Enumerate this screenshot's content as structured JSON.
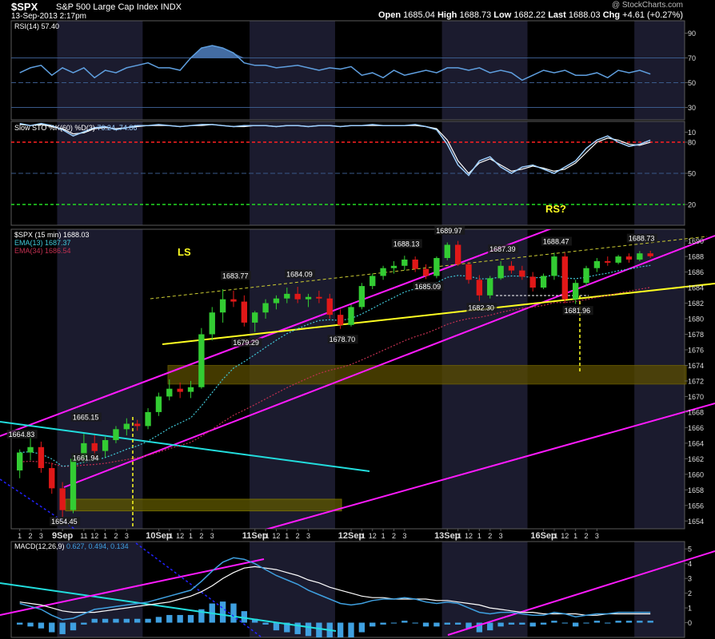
{
  "header": {
    "symbol": "$SPX",
    "name": "S&P 500 Large Cap Index",
    "exchange": "INDX",
    "datetime": "13-Sep-2013 2:17pm",
    "credit": "@ StockCharts.com",
    "open_label": "Open",
    "open": "1685.04",
    "high_label": "High",
    "high": "1688.73",
    "low_label": "Low",
    "low": "1682.22",
    "last_label": "Last",
    "last": "1688.03",
    "chg_label": "Chg",
    "chg": "+4.61 (+0.27%)"
  },
  "colors": {
    "background": "#000000",
    "panel_border": "#5a5a5a",
    "session_shade": "#1b1b2e",
    "candle_up": "#33cc33",
    "candle_down": "#e01818",
    "ema13": "#40c8d8",
    "ema34": "#c03050",
    "magenta": "#ff1aff",
    "cyan": "#22dddd",
    "yellow": "#ffff22",
    "rsi_line": "#5f9fdf",
    "sto_k": "#9fd0ff",
    "macd_hist": "#3fa0e0"
  },
  "chart_data": [
    {
      "panel": "rsi",
      "type": "line",
      "label": "RSI(14) 57.40",
      "ylim": [
        20,
        100
      ],
      "yticks": [
        90,
        70,
        50,
        30,
        10
      ],
      "reference_lines": [
        70,
        50,
        30
      ],
      "values": [
        58,
        62,
        64,
        56,
        62,
        58,
        62,
        54,
        60,
        58,
        62,
        64,
        66,
        62,
        62,
        60,
        70,
        78,
        80,
        78,
        74,
        66,
        64,
        64,
        62,
        63,
        64,
        62,
        60,
        62,
        61,
        63,
        56,
        58,
        54,
        60,
        56,
        58,
        60,
        58,
        62,
        62,
        60,
        62,
        58,
        60,
        58,
        52,
        56,
        60,
        58,
        60,
        56,
        56,
        58,
        54,
        60,
        58,
        60,
        57
      ]
    },
    {
      "panel": "sto",
      "type": "line",
      "label": "Slow STO %K(60) %D(3)",
      "label_values": "76.24, 74.86",
      "ylim": [
        0,
        100
      ],
      "yticks": [
        80,
        50,
        20
      ],
      "reference_lines": [
        80,
        50,
        20
      ],
      "k": [
        98,
        96,
        98,
        96,
        92,
        86,
        90,
        94,
        95,
        92,
        94,
        96,
        96,
        97,
        96,
        95,
        96,
        97,
        97,
        96,
        95,
        96,
        96,
        96,
        95,
        96,
        96,
        95,
        96,
        96,
        95,
        96,
        96,
        97,
        96,
        96,
        96,
        97,
        95,
        92,
        78,
        58,
        48,
        62,
        66,
        56,
        50,
        56,
        58,
        54,
        50,
        56,
        62,
        74,
        82,
        86,
        80,
        76,
        78,
        82
      ],
      "d": [
        97,
        96,
        97,
        95,
        93,
        88,
        89,
        93,
        94,
        93,
        94,
        95,
        96,
        96,
        96,
        95,
        96,
        96,
        97,
        96,
        95,
        95,
        96,
        96,
        95,
        96,
        96,
        95,
        96,
        96,
        95,
        96,
        96,
        96,
        96,
        96,
        96,
        96,
        95,
        93,
        82,
        62,
        50,
        60,
        64,
        58,
        52,
        54,
        57,
        55,
        52,
        54,
        60,
        70,
        80,
        84,
        82,
        78,
        77,
        80
      ]
    },
    {
      "panel": "price",
      "type": "candlestick",
      "label": "$SPX (15 min) 1688.03",
      "ema13_label": "EMA(13) 1687.37",
      "ema34_label": "EMA(34) 1686.54",
      "ylim": [
        1653,
        1691.5
      ],
      "yticks": [
        1690,
        1688,
        1686,
        1684,
        1682,
        1680,
        1678,
        1676,
        1674,
        1672,
        1670,
        1668,
        1666,
        1664,
        1662,
        1660,
        1658,
        1656,
        1654
      ],
      "candles": [
        [
          1660.5,
          1663.2,
          1659.5,
          1662.8
        ],
        [
          1662.8,
          1664.8,
          1661.8,
          1663.5
        ],
        [
          1663.5,
          1664.2,
          1660.2,
          1660.8
        ],
        [
          1660.8,
          1661.5,
          1657.5,
          1658.2
        ],
        [
          1658.2,
          1659.0,
          1654.5,
          1655.4
        ],
        [
          1655.4,
          1662.5,
          1655.0,
          1662.0
        ],
        [
          1662.0,
          1665.2,
          1661.5,
          1664.0
        ],
        [
          1664.0,
          1665.0,
          1662.0,
          1663.0
        ],
        [
          1663.0,
          1664.8,
          1662.2,
          1664.4
        ],
        [
          1664.4,
          1666.2,
          1664.0,
          1665.8
        ],
        [
          1665.8,
          1667.2,
          1665.0,
          1666.5
        ],
        [
          1666.5,
          1667.0,
          1665.6,
          1666.2
        ],
        [
          1666.2,
          1668.5,
          1665.8,
          1668.0
        ],
        [
          1668.0,
          1670.5,
          1667.5,
          1670.0
        ],
        [
          1670.0,
          1672.2,
          1669.5,
          1671.0
        ],
        [
          1671.0,
          1671.8,
          1669.8,
          1670.6
        ],
        [
          1670.6,
          1672.0,
          1669.8,
          1671.2
        ],
        [
          1671.2,
          1678.8,
          1671.0,
          1678.0
        ],
        [
          1678.0,
          1681.5,
          1677.2,
          1680.8
        ],
        [
          1680.8,
          1683.8,
          1679.5,
          1682.5
        ],
        [
          1682.5,
          1683.6,
          1681.5,
          1682.2
        ],
        [
          1682.2,
          1683.0,
          1679.0,
          1679.5
        ],
        [
          1679.5,
          1681.0,
          1678.3,
          1680.8
        ],
        [
          1680.8,
          1682.5,
          1680.0,
          1682.0
        ],
        [
          1682.0,
          1683.0,
          1681.2,
          1682.6
        ],
        [
          1682.6,
          1684.0,
          1682.0,
          1683.2
        ],
        [
          1683.2,
          1684.1,
          1682.0,
          1682.5
        ],
        [
          1682.5,
          1683.2,
          1681.5,
          1682.8
        ],
        [
          1682.8,
          1683.6,
          1682.0,
          1682.6
        ],
        [
          1682.6,
          1683.2,
          1680.0,
          1680.5
        ],
        [
          1680.5,
          1681.2,
          1678.7,
          1679.2
        ],
        [
          1679.2,
          1681.8,
          1679.0,
          1681.5
        ],
        [
          1681.5,
          1684.6,
          1681.2,
          1684.2
        ],
        [
          1684.2,
          1685.8,
          1683.8,
          1685.5
        ],
        [
          1685.5,
          1686.8,
          1685.0,
          1686.5
        ],
        [
          1686.5,
          1687.4,
          1685.8,
          1686.8
        ],
        [
          1686.8,
          1688.1,
          1686.2,
          1687.6
        ],
        [
          1687.6,
          1688.0,
          1686.0,
          1686.4
        ],
        [
          1686.4,
          1687.0,
          1685.1,
          1685.5
        ],
        [
          1685.5,
          1688.0,
          1685.2,
          1687.8
        ],
        [
          1687.8,
          1689.8,
          1687.5,
          1689.5
        ],
        [
          1689.5,
          1690.0,
          1686.8,
          1687.0
        ],
        [
          1687.0,
          1687.3,
          1684.5,
          1685.0
        ],
        [
          1685.0,
          1685.6,
          1682.3,
          1683.0
        ],
        [
          1683.0,
          1685.5,
          1682.6,
          1685.2
        ],
        [
          1685.2,
          1687.4,
          1685.0,
          1686.8
        ],
        [
          1686.8,
          1687.4,
          1685.8,
          1686.2
        ],
        [
          1686.2,
          1686.8,
          1685.0,
          1685.4
        ],
        [
          1685.4,
          1686.0,
          1683.5,
          1684.0
        ],
        [
          1684.0,
          1685.8,
          1683.8,
          1685.5
        ],
        [
          1685.5,
          1688.5,
          1685.0,
          1688.0
        ],
        [
          1688.0,
          1688.5,
          1682.0,
          1682.5
        ],
        [
          1682.5,
          1685.0,
          1681.9,
          1684.6
        ],
        [
          1684.6,
          1686.8,
          1684.2,
          1686.5
        ],
        [
          1686.5,
          1687.8,
          1686.0,
          1687.4
        ],
        [
          1687.4,
          1688.0,
          1686.8,
          1687.2
        ],
        [
          1687.2,
          1688.2,
          1687.0,
          1688.0
        ],
        [
          1688.0,
          1688.4,
          1687.2,
          1687.6
        ],
        [
          1687.6,
          1688.7,
          1687.4,
          1688.4
        ],
        [
          1688.4,
          1688.73,
          1687.8,
          1688.03
        ]
      ],
      "price_labels": [
        {
          "text": "1664.83",
          "i": 0,
          "y": 1664.8
        },
        {
          "text": "1665.15",
          "i": 6,
          "y": 1667.0
        },
        {
          "text": "1661.94",
          "i": 6,
          "y": 1661.8
        },
        {
          "text": "1654.45",
          "i": 4,
          "y": 1653.6
        },
        {
          "text": "1683.77",
          "i": 20,
          "y": 1685.2
        },
        {
          "text": "1679.29",
          "i": 21,
          "y": 1676.6
        },
        {
          "text": "1684.09",
          "i": 26,
          "y": 1685.4
        },
        {
          "text": "1678.70",
          "i": 30,
          "y": 1677.0
        },
        {
          "text": "1688.13",
          "i": 36,
          "y": 1689.3
        },
        {
          "text": "1685.09",
          "i": 38,
          "y": 1683.8
        },
        {
          "text": "1689.97",
          "i": 40,
          "y": 1691.0
        },
        {
          "text": "1687.39",
          "i": 45,
          "y": 1688.6
        },
        {
          "text": "1682.30",
          "i": 43,
          "y": 1681.1
        },
        {
          "text": "1688.47",
          "i": 50,
          "y": 1689.6
        },
        {
          "text": "1681.96",
          "i": 52,
          "y": 1680.7
        },
        {
          "text": "1688.73",
          "i": 58,
          "y": 1690.0
        }
      ],
      "annotations": [
        {
          "text": "LS"
        },
        {
          "text": "RS?"
        }
      ]
    },
    {
      "panel": "macd",
      "type": "line",
      "label": "MACD(12,26,9)",
      "label_values": "0.627, 0.494, 0.134",
      "ylim": [
        -1,
        5.5
      ],
      "yticks": [
        5,
        4,
        3,
        2,
        1,
        0
      ],
      "macd": [
        1.3,
        1.1,
        0.9,
        0.5,
        0.2,
        0.3,
        0.6,
        0.9,
        1.0,
        1.1,
        1.2,
        1.3,
        1.4,
        1.6,
        1.8,
        2.0,
        2.2,
        2.8,
        3.5,
        4.1,
        4.4,
        4.3,
        4.0,
        3.6,
        3.2,
        2.9,
        2.6,
        2.2,
        1.9,
        1.6,
        1.3,
        1.2,
        1.3,
        1.5,
        1.6,
        1.6,
        1.7,
        1.6,
        1.4,
        1.3,
        1.4,
        1.3,
        1.0,
        0.7,
        0.6,
        0.7,
        0.7,
        0.6,
        0.5,
        0.5,
        0.7,
        0.6,
        0.4,
        0.5,
        0.6,
        0.6,
        0.7,
        0.7,
        0.7,
        0.7
      ],
      "signal": [
        1.4,
        1.3,
        1.2,
        1.0,
        0.8,
        0.7,
        0.7,
        0.7,
        0.8,
        0.9,
        1.0,
        1.1,
        1.2,
        1.3,
        1.4,
        1.6,
        1.8,
        2.1,
        2.5,
        3.0,
        3.4,
        3.7,
        3.8,
        3.7,
        3.6,
        3.4,
        3.2,
        2.9,
        2.7,
        2.4,
        2.2,
        2.0,
        1.8,
        1.7,
        1.7,
        1.6,
        1.6,
        1.6,
        1.6,
        1.5,
        1.5,
        1.4,
        1.3,
        1.2,
        1.0,
        0.9,
        0.8,
        0.7,
        0.7,
        0.6,
        0.6,
        0.6,
        0.6,
        0.5,
        0.5,
        0.6,
        0.6,
        0.6,
        0.6,
        0.6
      ]
    }
  ],
  "x_axis": {
    "labels": [
      {
        "text": "1",
        "i": 0
      },
      {
        "text": "2",
        "i": 1
      },
      {
        "text": "3",
        "i": 2
      },
      {
        "text": "9Sep",
        "i": 4
      },
      {
        "text": "11",
        "i": 6
      },
      {
        "text": "12",
        "i": 7
      },
      {
        "text": "1",
        "i": 8
      },
      {
        "text": "2",
        "i": 9
      },
      {
        "text": "3",
        "i": 10
      },
      {
        "text": "10Sep",
        "i": 13
      },
      {
        "text": "11",
        "i": 14
      },
      {
        "text": "12",
        "i": 15
      },
      {
        "text": "1",
        "i": 16
      },
      {
        "text": "2",
        "i": 17
      },
      {
        "text": "3",
        "i": 18
      },
      {
        "text": "11Sep",
        "i": 22
      },
      {
        "text": "11",
        "i": 23
      },
      {
        "text": "12",
        "i": 24
      },
      {
        "text": "1",
        "i": 25
      },
      {
        "text": "2",
        "i": 26
      },
      {
        "text": "3",
        "i": 27
      },
      {
        "text": "12Sep",
        "i": 31
      },
      {
        "text": "11",
        "i": 32
      },
      {
        "text": "12",
        "i": 33
      },
      {
        "text": "1",
        "i": 34
      },
      {
        "text": "2",
        "i": 35
      },
      {
        "text": "3",
        "i": 36
      },
      {
        "text": "13Sep",
        "i": 40
      },
      {
        "text": "11",
        "i": 41
      },
      {
        "text": "12",
        "i": 42
      },
      {
        "text": "1",
        "i": 43
      },
      {
        "text": "2",
        "i": 44
      },
      {
        "text": "3",
        "i": 45
      },
      {
        "text": "16Sep",
        "i": 49
      },
      {
        "text": "11",
        "i": 50
      },
      {
        "text": "12",
        "i": 51
      },
      {
        "text": "1",
        "i": 52
      },
      {
        "text": "2",
        "i": 53
      },
      {
        "text": "3",
        "i": 54
      }
    ]
  }
}
